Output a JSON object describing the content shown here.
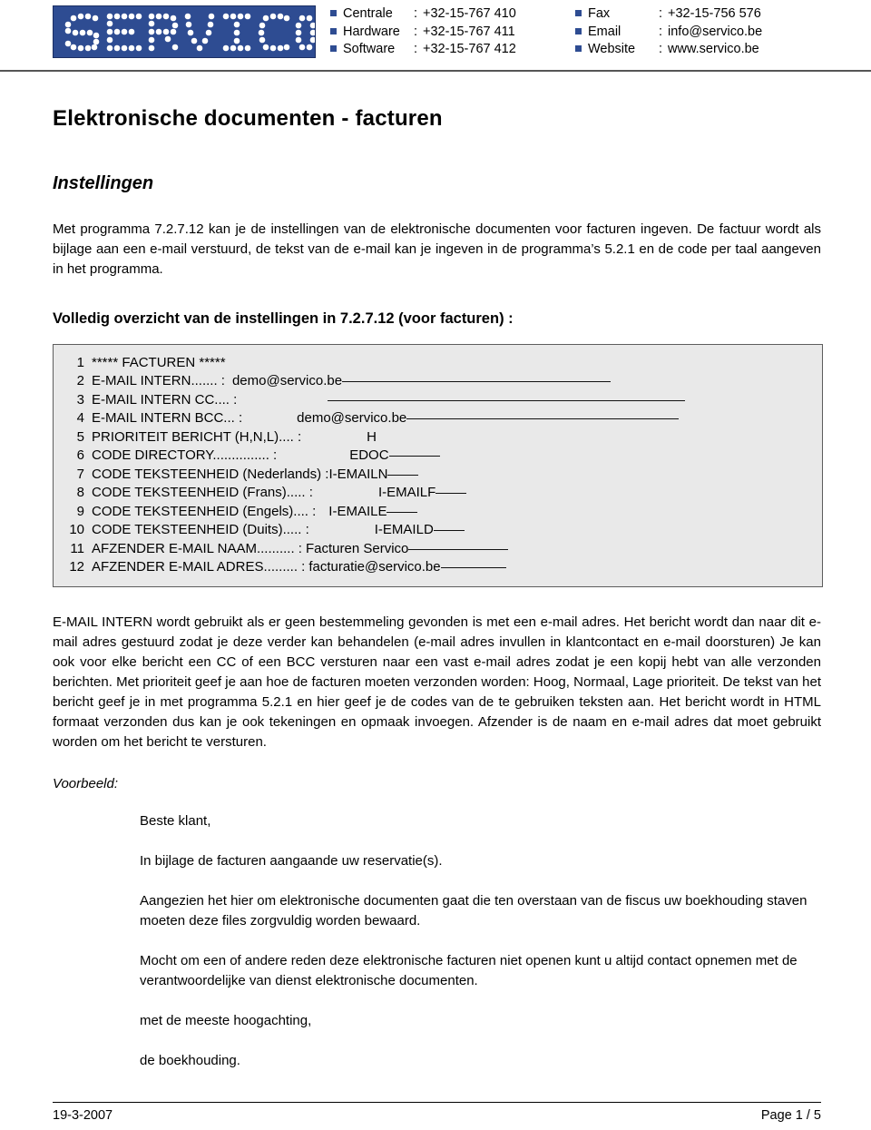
{
  "header": {
    "logo_text": "SERVICO",
    "contacts_left": [
      {
        "label": "Centrale",
        "sep": ":",
        "value": "+32-15-767 410"
      },
      {
        "label": "Hardware",
        "sep": ":",
        "value": "+32-15-767 411"
      },
      {
        "label": "Software",
        "sep": ":",
        "value": "+32-15-767 412"
      }
    ],
    "contacts_right": [
      {
        "label": "Fax",
        "sep": ":",
        "value": "+32-15-756 576"
      },
      {
        "label": "Email",
        "sep": ":",
        "value": "info@servico.be"
      },
      {
        "label": "Website",
        "sep": ":",
        "value": "www.servico.be"
      }
    ],
    "brand_color": "#2e4c92"
  },
  "document": {
    "title": "Elektronische documenten - facturen",
    "subtitle": "Instellingen",
    "intro_paragraph": "Met programma 7.2.7.12 kan je de instellingen van de elektronische documenten voor facturen ingeven.  De factuur wordt als bijlage aan een e-mail verstuurd, de tekst van de e-mail kan je ingeven in de programma’s 5.2.1 en de code per taal aangeven in het programma.",
    "section_heading": "Volledig overzicht van de instellingen in 7.2.7.12 (voor facturen) :",
    "explanation_paragraph": "E-MAIL INTERN wordt gebruikt als er geen bestemmeling gevonden is met een e-mail adres.  Het bericht wordt dan naar dit e-mail adres gestuurd zodat je deze verder kan behandelen (e-mail adres invullen in klantcontact en e-mail doorsturen)  Je kan ook voor elke bericht een CC of een BCC versturen naar een vast e-mail adres zodat je een kopij hebt van alle verzonden berichten.  Met prioriteit geef je aan hoe de facturen moeten verzonden worden: Hoog, Normaal, Lage prioriteit.  De tekst van het bericht geef je in met programma 5.2.1 en hier geef je de codes van de te gebruiken teksten aan. Het bericht wordt in HTML formaat verzonden dus kan je ook tekeningen en opmaak invoegen. Afzender is de naam en e-mail adres dat moet gebruikt worden om het bericht te versturen.",
    "voorbeeld_label": "Voorbeeld:"
  },
  "settings_block": {
    "lines": [
      {
        "num": "1",
        "text": "***** FACTUREN *****",
        "value": "",
        "pad": 0,
        "underline": 0
      },
      {
        "num": "2",
        "text": "E-MAIL INTERN....... :",
        "value": "demo@servico.be",
        "pad": 8,
        "underline": 296
      },
      {
        "num": "3",
        "text": "E-MAIL INTERN CC.... :",
        "value": "",
        "pad": 100,
        "underline": 394
      },
      {
        "num": "4",
        "text": "E-MAIL INTERN BCC... :",
        "value": "demo@servico.be",
        "pad": 60,
        "underline": 300
      },
      {
        "num": "5",
        "text": "PRIORITEIT BERICHT (H,N,L).... :",
        "value": "H",
        "pad": 72,
        "underline": 0
      },
      {
        "num": "6",
        "text": "CODE DIRECTORY............... :",
        "value": "EDOC",
        "pad": 80,
        "underline": 56
      },
      {
        "num": "7",
        "text": "CODE TEKSTEENHEID (Nederlands) :",
        "value": "I-EMAILN",
        "pad": 0,
        "underline": 34
      },
      {
        "num": "8",
        "text": "CODE TEKSTEENHEID (Frans)..... :",
        "value": "I-EMAILF",
        "pad": 72,
        "underline": 34
      },
      {
        "num": "9",
        "text": "CODE TEKSTEENHEID (Engels).... :",
        "value": "I-EMAILE",
        "pad": 14,
        "underline": 34
      },
      {
        "num": "10",
        "text": "CODE TEKSTEENHEID (Duits)..... :",
        "value": "I-EMAILD",
        "pad": 72,
        "underline": 34
      },
      {
        "num": "11",
        "text": "AFZENDER E-MAIL NAAM.......... :",
        "value": "Facturen Servico",
        "pad": 4,
        "underline": 110
      },
      {
        "num": "12",
        "text": "AFZENDER E-MAIL ADRES......... :",
        "value": "facturatie@servico.be",
        "pad": 4,
        "underline": 72
      }
    ]
  },
  "example_letter": {
    "paragraphs": [
      "Beste klant,",
      "In bijlage de facturen aangaande uw reservatie(s).",
      "Aangezien het hier om elektronische documenten gaat die ten overstaan van de fiscus uw boekhouding staven moeten deze files zorgvuldig worden bewaard.",
      "Mocht om een of andere reden deze elektronische facturen niet openen kunt u altijd contact opnemen met de verantwoordelijke van dienst elektronische documenten.",
      "met de meeste hoogachting,",
      "de boekhouding."
    ]
  },
  "footer": {
    "date": "19-3-2007",
    "page": "Page 1 / 5"
  }
}
